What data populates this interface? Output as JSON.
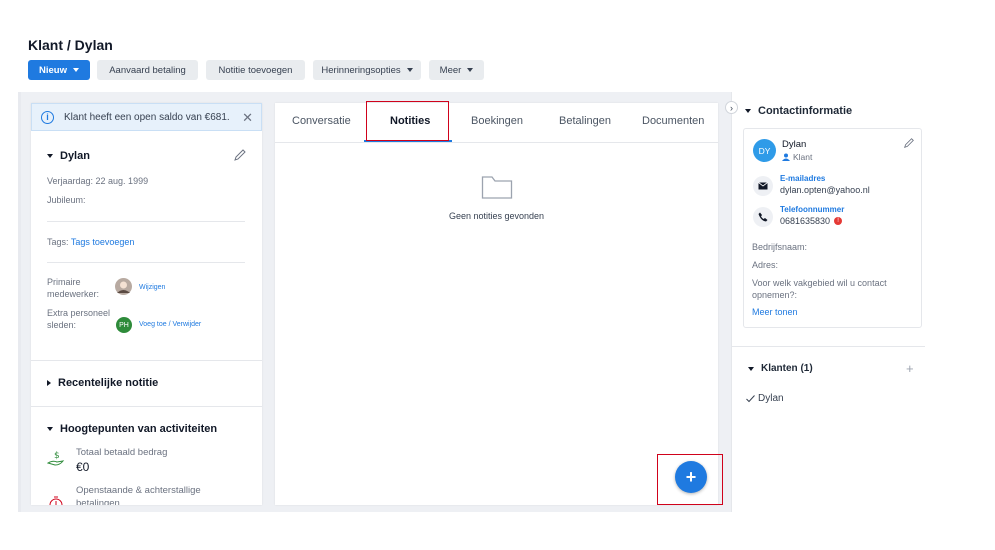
{
  "header": {
    "title": "Klant / Dylan",
    "buttons": {
      "nieuw": "Nieuw",
      "aanvaard": "Aanvaard betaling",
      "notitie": "Notitie toevoegen",
      "herinnering": "Herinneringsopties",
      "meer": "Meer"
    }
  },
  "alert": {
    "text": "Klant heeft een open saldo van €681."
  },
  "customer": {
    "name": "Dylan",
    "birthday": "Verjaardag: 22 aug. 1999",
    "jubileum": "Jubileum:",
    "tags_label": "Tags:",
    "tags_link": "Tags toevoegen",
    "primary_label": "Primaire medewerker:",
    "primary_link": "Wijzigen",
    "extra_label": "Extra personeelsleden:",
    "extra_initials": "PH",
    "extra_link": "Voeg toe / Verwijder"
  },
  "sections": {
    "recent_note": "Recentelijke notitie",
    "highlights": "Hoogtepunten van activiteiten",
    "total_paid_label": "Totaal betaald bedrag",
    "total_paid_value": "€0",
    "outstanding_label": "Openstaande & achterstallige betalingen"
  },
  "tabs": [
    "Conversatie",
    "Notities",
    "Boekingen",
    "Betalingen",
    "Documenten"
  ],
  "notes": {
    "empty": "Geen notities gevonden"
  },
  "fab": {
    "label": "+"
  },
  "contact": {
    "heading": "Contactinformatie",
    "name": "Dylan",
    "initials": "DY",
    "role": "Klant",
    "email_label": "E-mailadres",
    "email": "dylan.opten@yahoo.nl",
    "phone_label": "Telefoonnummer",
    "phone": "0681635830",
    "company": "Bedrijfsnaam:",
    "address": "Adres:",
    "question": "Voor welk vakgebied wil u contact opnemen?:",
    "more": "Meer tonen"
  },
  "clients": {
    "heading": "Klanten (1)",
    "add": "+",
    "item": "Dylan"
  },
  "colors": {
    "accent": "#1f7ae0",
    "highlight": "#d0021b",
    "avatar": "#2f9be8",
    "staff": "#2e8b3a"
  }
}
